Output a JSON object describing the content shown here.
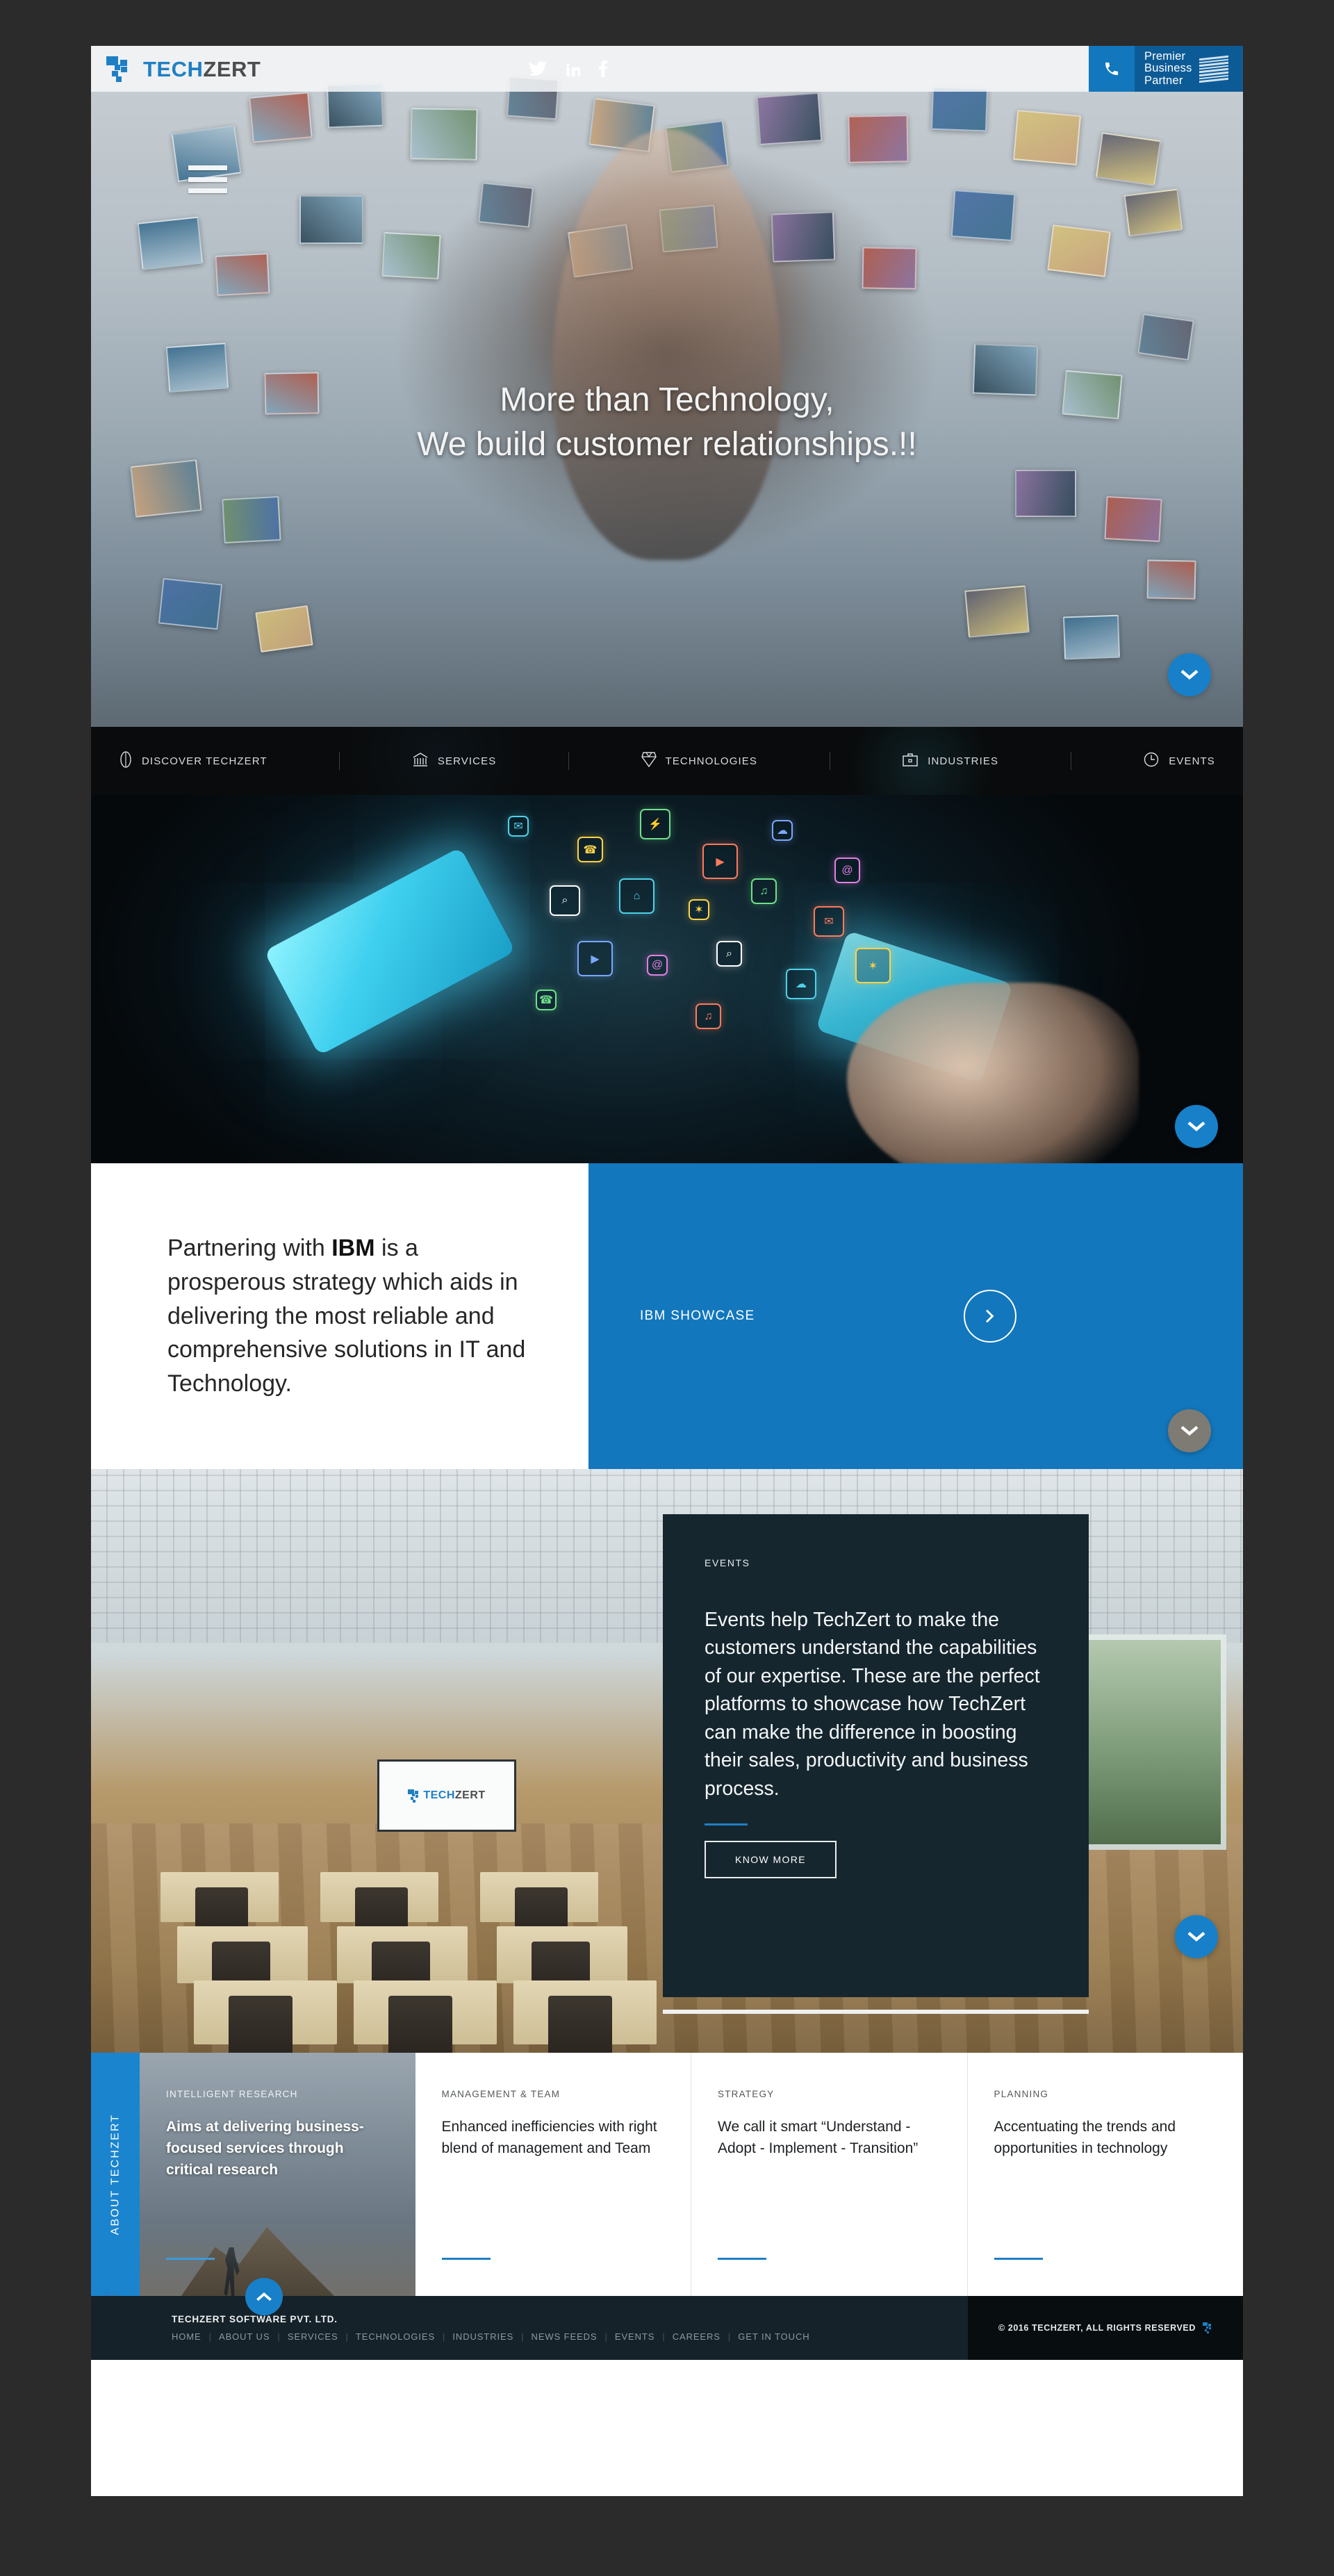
{
  "brand": {
    "name_part1": "TECH",
    "name_part2": "ZERT",
    "logo_icon": "techzert-blocks-logo"
  },
  "header": {
    "social": [
      {
        "name": "twitter-icon",
        "label": "Twitter"
      },
      {
        "name": "linkedin-icon",
        "label": "LinkedIn"
      },
      {
        "name": "facebook-icon",
        "label": "Facebook"
      }
    ],
    "phone_icon": "phone-icon",
    "partner_line1": "Premier",
    "partner_line2": "Business",
    "partner_line3": "Partner",
    "partner_logo": "ibm-logo",
    "menu_icon": "hamburger-menu-icon"
  },
  "hero": {
    "headline_line1": "More than Technology,",
    "headline_line2": "We build customer relationships.!!",
    "scroll_icon": "chevron-down-icon"
  },
  "nav": {
    "items": [
      {
        "label": "DISCOVER TECHZERT",
        "icon": "leaf-icon"
      },
      {
        "label": "SERVICES",
        "icon": "bank-columns-icon"
      },
      {
        "label": "TECHNOLOGIES",
        "icon": "diamond-icon"
      },
      {
        "label": "INDUSTRIES",
        "icon": "briefcase-icon"
      },
      {
        "label": "EVENTS",
        "icon": "clock-icon"
      }
    ]
  },
  "appband": {
    "scroll_icon": "chevron-down-icon"
  },
  "ibm": {
    "paragraph_before": "Partnering with ",
    "paragraph_bold": "IBM",
    "paragraph_after": " is a prosperous strategy which aids in delivering the most reliable and comprehensive solutions in IT and Technology.",
    "showcase_label": "IBM SHOWCASE",
    "arrow_icon": "chevron-right-icon",
    "scroll_icon": "chevron-down-icon",
    "accent_color": "#1277bd"
  },
  "events": {
    "kicker": "EVENTS",
    "body": "Events help TechZert to make the customers understand the capabilities of our expertise. These are the perfect platforms to showcase how TechZert can make the difference in boosting their sales, productivity and business process.",
    "button_label": "KNOW MORE",
    "scroll_icon": "chevron-down-icon",
    "panel_color": "#16262f",
    "screen_logo": "techzert-logo-on-projection-screen"
  },
  "about": {
    "tab_label": "ABOUT TECHZERT",
    "cards": [
      {
        "kicker": "INTELLIGENT RESEARCH",
        "title": "Aims at delivering business-focused services through critical research"
      },
      {
        "kicker": "MANAGEMENT & TEAM",
        "title": "Enhanced inefficiencies with right blend of management and Team"
      },
      {
        "kicker": "STRATEGY",
        "title": "We call it smart “Understand - Adopt - Implement - Transition”"
      },
      {
        "kicker": "PLANNING",
        "title": "Accentuating the trends and opportunities in technology"
      }
    ]
  },
  "footer": {
    "company": "TECHZERT SOFTWARE PVT. LTD.",
    "links": [
      "HOME",
      "ABOUT US",
      "SERVICES",
      "TECHNOLOGIES",
      "INDUSTRIES",
      "NEWS FEEDS",
      "EVENTS",
      "CAREERS",
      "GET IN TOUCH"
    ],
    "copyright": "© 2016 TECHZERT, ALL RIGHTS RESERVED",
    "to_top_icon": "chevron-up-icon"
  }
}
